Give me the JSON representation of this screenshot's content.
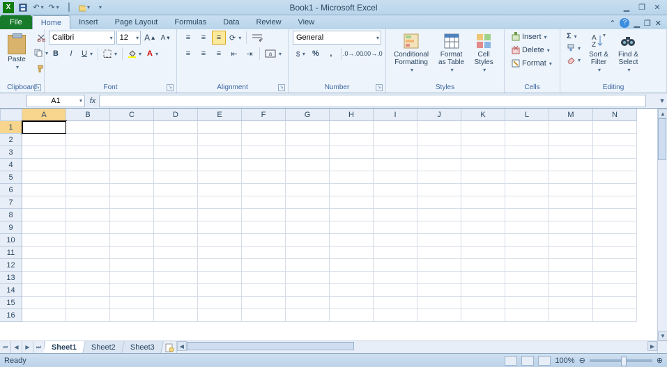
{
  "title": "Book1 - Microsoft Excel",
  "tabs": {
    "file": "File",
    "items": [
      "Home",
      "Insert",
      "Page Layout",
      "Formulas",
      "Data",
      "Review",
      "View"
    ],
    "active": "Home"
  },
  "ribbon": {
    "clipboard": {
      "label": "Clipboard",
      "paste": "Paste"
    },
    "font": {
      "label": "Font",
      "name": "Calibri",
      "size": "12",
      "bold": "B",
      "italic": "I",
      "underline": "U"
    },
    "alignment": {
      "label": "Alignment"
    },
    "number": {
      "label": "Number",
      "format": "General"
    },
    "styles": {
      "label": "Styles",
      "conditional": "Conditional\nFormatting",
      "table": "Format\nas Table",
      "cell": "Cell\nStyles"
    },
    "cells": {
      "label": "Cells",
      "insert": "Insert",
      "delete": "Delete",
      "format": "Format"
    },
    "editing": {
      "label": "Editing",
      "sort": "Sort &\nFilter",
      "find": "Find &\nSelect"
    }
  },
  "namebox": "A1",
  "columns": [
    "A",
    "B",
    "C",
    "D",
    "E",
    "F",
    "G",
    "H",
    "I",
    "J",
    "K",
    "L",
    "M",
    "N"
  ],
  "rows": [
    "1",
    "2",
    "3",
    "4",
    "5",
    "6",
    "7",
    "8",
    "9",
    "10",
    "11",
    "12",
    "13",
    "14",
    "15",
    "16"
  ],
  "active_cell": {
    "col": 0,
    "row": 0
  },
  "sheet_tabs": [
    "Sheet1",
    "Sheet2",
    "Sheet3"
  ],
  "active_sheet": "Sheet1",
  "status": {
    "ready": "Ready",
    "zoom": "100%"
  }
}
